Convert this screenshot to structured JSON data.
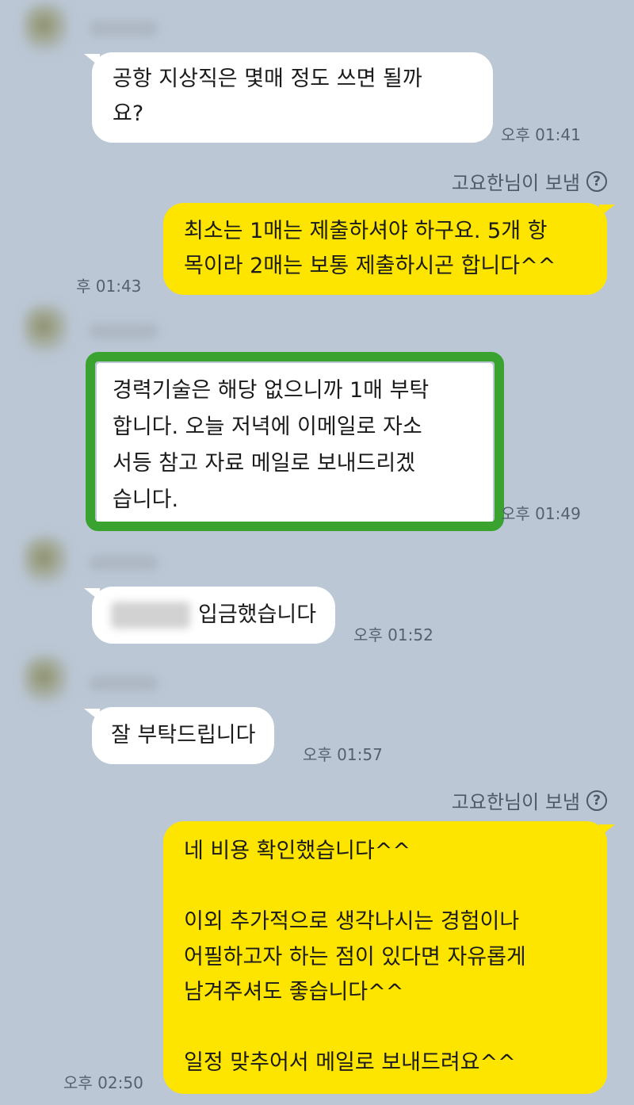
{
  "colors": {
    "background": "#bbc7d5",
    "incoming_bubble": "#ffffff",
    "outgoing_bubble": "#fde500",
    "highlight_border": "#3aa22e"
  },
  "messages": [
    {
      "text": "공항 지상직은 몇매 정도 쓰면 될까\n요?",
      "time": "오후 01:41"
    },
    {
      "sender_note": "고요한님이 보냄",
      "text": "최소는 1매는 제출하셔야 하구요. 5개 항\n목이라 2매는 보통 제출하시곤 합니다^^",
      "time": "후 01:43"
    },
    {
      "text": "경력기술은 해당 없으니까 1매 부탁\n합니다. 오늘 저녁에 이메일로 자소\n서등 참고 자료 메일로 보내드리겠\n습니다.",
      "time": "오후 01:49"
    },
    {
      "text": "입금했습니다",
      "time": "오후 01:52"
    },
    {
      "text": "잘 부탁드립니다",
      "time": "오후 01:57"
    },
    {
      "sender_note": "고요한님이 보냄",
      "text": "네 비용 확인했습니다^^\n\n이외 추가적으로 생각나시는 경험이나\n어필하고자 하는 점이 있다면 자유롭게\n남겨주셔도 좋습니다^^\n\n일정 맞추어서 메일로 보내드려요^^",
      "time": "오후 02:50"
    }
  ],
  "help_icon": "question-circle-icon"
}
